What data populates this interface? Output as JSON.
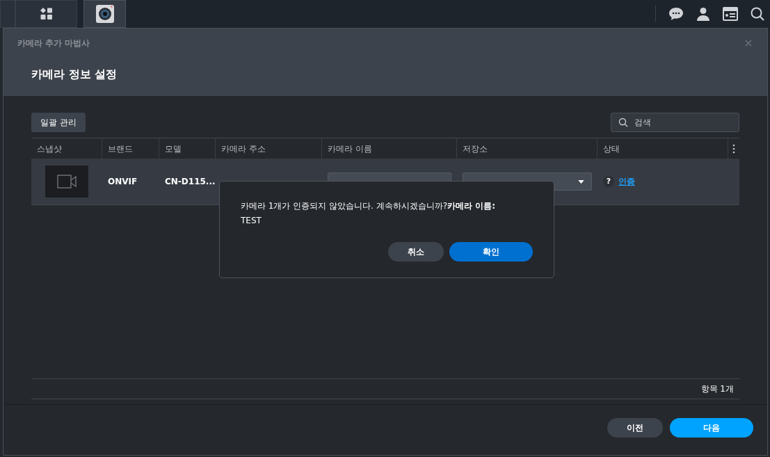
{
  "taskbar": {
    "apps": [
      {
        "kind": "grid",
        "selected": false
      },
      {
        "kind": "camera",
        "selected": true
      }
    ],
    "tools": [
      {
        "kind": "chat"
      },
      {
        "kind": "user"
      },
      {
        "kind": "widgets"
      },
      {
        "kind": "search"
      }
    ]
  },
  "window": {
    "title": "카메라 추가 마법사",
    "heading": "카메라 정보 설정"
  },
  "toolbar": {
    "bulk_button": "일괄 관리",
    "search": {
      "placeholder": "검색"
    }
  },
  "table": {
    "columns": [
      "스냅샷",
      "브랜드",
      "모델",
      "카메라 주소",
      "카메라 이름",
      "저장소",
      "상태"
    ],
    "rows": [
      {
        "brand": "ONVIF",
        "model": "CN-D115...",
        "status_icon": "?",
        "status_link": "인증"
      }
    ]
  },
  "item_count": "항목 1개",
  "dialog": {
    "message": "카메라 1개가 인증되지 않았습니다. 계속하시겠습니까?**카메라 이름:**",
    "detail": "TEST",
    "buttons": [
      {
        "label": "취소",
        "primary": false
      },
      {
        "label": "확인",
        "primary": true
      }
    ]
  },
  "footer": {
    "buttons": [
      {
        "label": "이전",
        "primary": false
      },
      {
        "label": "다음",
        "primary": true
      }
    ]
  }
}
